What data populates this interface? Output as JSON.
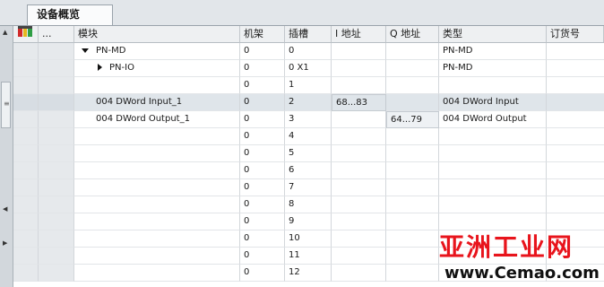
{
  "tab": {
    "title": "设备概览"
  },
  "header": {
    "icon": "network-device-icon",
    "dots": "...",
    "module": "模块",
    "rack": "机架",
    "slot": "插槽",
    "i_address": "I 地址",
    "q_address": "Q 地址",
    "type": "类型",
    "order_no": "订货号"
  },
  "rows": [
    {
      "module": "PN-MD",
      "rack": "0",
      "slot": "0",
      "i": "",
      "q": "",
      "type": "PN-MD",
      "expander": "down"
    },
    {
      "module": "PN-IO",
      "rack": "0",
      "slot": "0 X1",
      "i": "",
      "q": "",
      "type": "PN-MD",
      "expander": "right"
    },
    {
      "module": "",
      "rack": "0",
      "slot": "1",
      "i": "",
      "q": "",
      "type": ""
    },
    {
      "module": "004 DWord Input_1",
      "rack": "0",
      "slot": "2",
      "i": "68...83",
      "q": "",
      "type": "004 DWord Input",
      "selected": true
    },
    {
      "module": "004 DWord Output_1",
      "rack": "0",
      "slot": "3",
      "i": "",
      "q": "64...79",
      "type": "004 DWord Output"
    },
    {
      "module": "",
      "rack": "0",
      "slot": "4",
      "i": "",
      "q": "",
      "type": ""
    },
    {
      "module": "",
      "rack": "0",
      "slot": "5",
      "i": "",
      "q": "",
      "type": ""
    },
    {
      "module": "",
      "rack": "0",
      "slot": "6",
      "i": "",
      "q": "",
      "type": ""
    },
    {
      "module": "",
      "rack": "0",
      "slot": "7",
      "i": "",
      "q": "",
      "type": ""
    },
    {
      "module": "",
      "rack": "0",
      "slot": "8",
      "i": "",
      "q": "",
      "type": ""
    },
    {
      "module": "",
      "rack": "0",
      "slot": "9",
      "i": "",
      "q": "",
      "type": ""
    },
    {
      "module": "",
      "rack": "0",
      "slot": "10",
      "i": "",
      "q": "",
      "type": ""
    },
    {
      "module": "",
      "rack": "0",
      "slot": "11",
      "i": "",
      "q": "",
      "type": ""
    },
    {
      "module": "",
      "rack": "0",
      "slot": "12",
      "i": "",
      "q": "",
      "type": ""
    }
  ],
  "watermark": {
    "title": "亚洲工业网",
    "url": "www.Cemao.com"
  }
}
